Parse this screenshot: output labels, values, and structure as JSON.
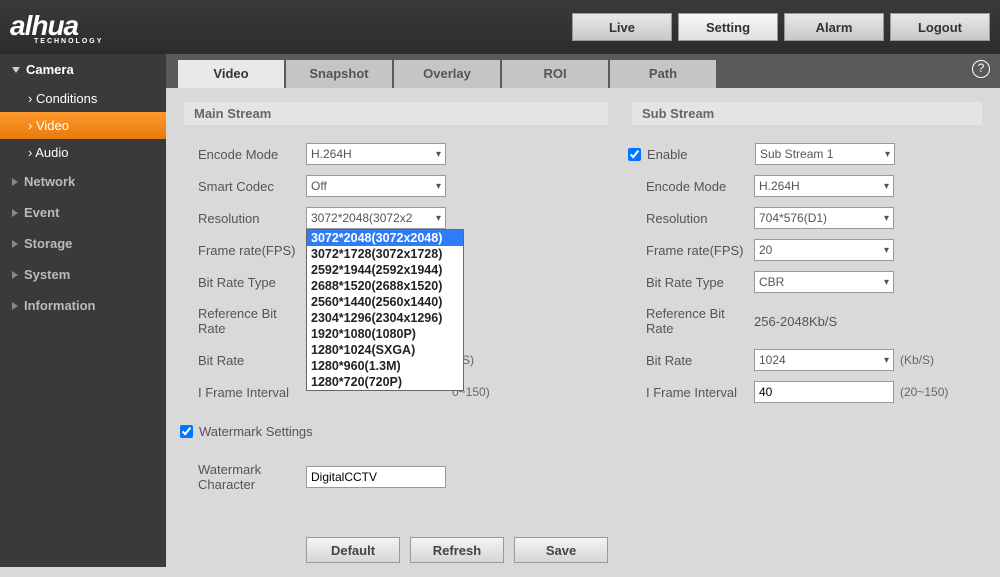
{
  "logo": {
    "brand": "alhua",
    "tag": "TECHNOLOGY"
  },
  "topnav": {
    "live": "Live",
    "setting": "Setting",
    "alarm": "Alarm",
    "logout": "Logout"
  },
  "sidebar": {
    "camera": "Camera",
    "camera_items": {
      "conditions": "Conditions",
      "video": "Video",
      "audio": "Audio"
    },
    "network": "Network",
    "event": "Event",
    "storage": "Storage",
    "system": "System",
    "information": "Information"
  },
  "tabs": {
    "video": "Video",
    "snapshot": "Snapshot",
    "overlay": "Overlay",
    "roi": "ROI",
    "path": "Path"
  },
  "help": "?",
  "main_stream": {
    "title": "Main Stream",
    "labels": {
      "encode_mode": "Encode Mode",
      "smart_codec": "Smart Codec",
      "resolution": "Resolution",
      "frame_rate": "Frame rate(FPS)",
      "bit_rate_type": "Bit Rate Type",
      "reference_bit_rate": "Reference Bit Rate",
      "bit_rate": "Bit Rate",
      "bit_rate_unit": "b/S)",
      "i_frame": "I Frame Interval",
      "i_frame_range": "0~150)",
      "watermark_settings": "Watermark Settings",
      "watermark_char": "Watermark Character"
    },
    "values": {
      "encode_mode": "H.264H",
      "smart_codec": "Off",
      "resolution": "3072*2048(3072x2",
      "watermark_char": "DigitalCCTV"
    },
    "resolution_options": [
      "3072*2048(3072x2048)",
      "3072*1728(3072x1728)",
      "2592*1944(2592x1944)",
      "2688*1520(2688x1520)",
      "2560*1440(2560x1440)",
      "2304*1296(2304x1296)",
      "1920*1080(1080P)",
      "1280*1024(SXGA)",
      "1280*960(1.3M)",
      "1280*720(720P)"
    ]
  },
  "sub_stream": {
    "title": "Sub Stream",
    "labels": {
      "enable": "Enable",
      "encode_mode": "Encode Mode",
      "resolution": "Resolution",
      "frame_rate": "Frame rate(FPS)",
      "bit_rate_type": "Bit Rate Type",
      "reference_bit_rate": "Reference Bit Rate",
      "reference_value": "256-2048Kb/S",
      "bit_rate": "Bit Rate",
      "bit_rate_unit": "(Kb/S)",
      "i_frame": "I Frame Interval",
      "i_frame_range": "(20~150)"
    },
    "values": {
      "substream": "Sub Stream 1",
      "encode_mode": "H.264H",
      "resolution": "704*576(D1)",
      "frame_rate": "20",
      "bit_rate_type": "CBR",
      "bit_rate": "1024",
      "i_frame": "40"
    }
  },
  "buttons": {
    "default": "Default",
    "refresh": "Refresh",
    "save": "Save"
  }
}
